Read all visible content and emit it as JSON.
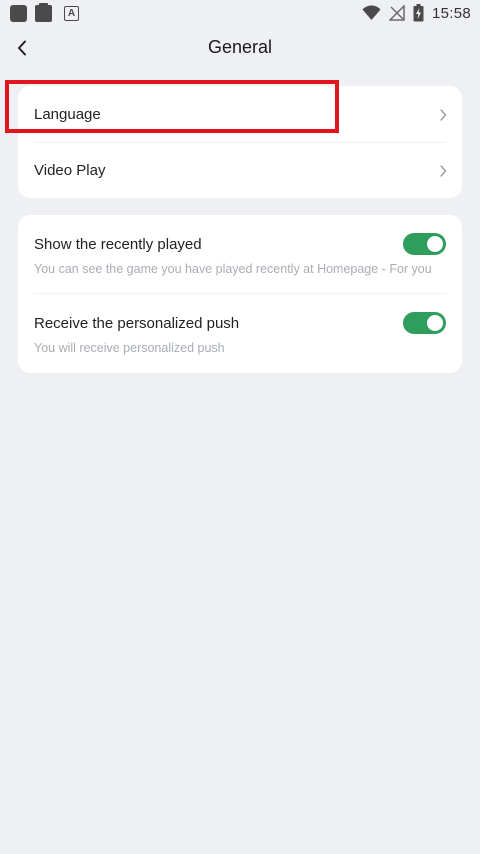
{
  "status_bar": {
    "time": "15:58",
    "left_icons": [
      "app-icon",
      "clipboard-icon",
      "keyboard-a-icon"
    ],
    "right_icons": [
      "wifi-icon",
      "no-signal-icon",
      "battery-charging-icon"
    ],
    "keyboard_glyph": "A"
  },
  "header": {
    "title": "General",
    "back_icon": "back-arrow-icon"
  },
  "card1": {
    "items": [
      {
        "label": "Language",
        "icon": "chevron-right-icon"
      },
      {
        "label": "Video Play",
        "icon": "chevron-right-icon"
      }
    ]
  },
  "card2": {
    "items": [
      {
        "label": "Show the recently played",
        "description": "You can see the game you have played recently at Homepage - For you",
        "enabled": true
      },
      {
        "label": "Receive the personalized push",
        "description": "You will receive personalized push",
        "enabled": true
      }
    ]
  },
  "colors": {
    "background": "#eef0f3",
    "card": "#ffffff",
    "toggle_on": "#2f9e5c",
    "highlight": "#e2141e",
    "description_text": "#a9adb3"
  }
}
